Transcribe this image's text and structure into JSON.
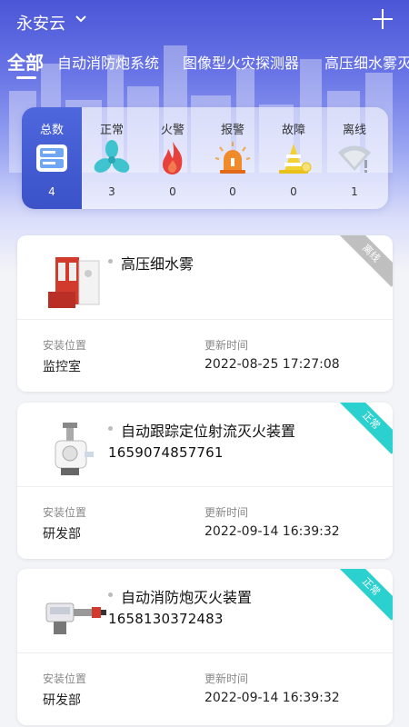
{
  "header": {
    "title": "永安云"
  },
  "tabs": [
    {
      "label": "全部"
    },
    {
      "label": "自动消防炮系统"
    },
    {
      "label": "图像型火灾探测器"
    },
    {
      "label": "高压细水雾灭"
    }
  ],
  "stats": [
    {
      "label": "总数",
      "count": "4",
      "icon": "list-icon"
    },
    {
      "label": "正常",
      "count": "3",
      "icon": "fan-icon"
    },
    {
      "label": "火警",
      "count": "0",
      "icon": "flame-icon"
    },
    {
      "label": "报警",
      "count": "0",
      "icon": "siren-icon"
    },
    {
      "label": "故障",
      "count": "0",
      "icon": "cone-icon"
    },
    {
      "label": "离线",
      "count": "1",
      "icon": "offline-icon"
    }
  ],
  "field_labels": {
    "location": "安装位置",
    "updated": "更新时间"
  },
  "devices": [
    {
      "name": "高压细水雾",
      "code": "",
      "location": "监控室",
      "updated": "2022-08-25 17:27:08",
      "status": "离线"
    },
    {
      "name": "自动跟踪定位射流灭火装置",
      "code": "1659074857761",
      "location": "研发部",
      "updated": "2022-09-14 16:39:32",
      "status": "正常"
    },
    {
      "name": "自动消防炮灭火装置",
      "code": "1658130372483",
      "location": "研发部",
      "updated": "2022-09-14 16:39:32",
      "status": "正常"
    }
  ],
  "colors": {
    "primary": "#4e67dc",
    "normal": "#2bd1cf",
    "offline": "#bfbfbf",
    "fire": "#e8403a",
    "alarm": "#f08a2a",
    "fault": "#f2d233"
  }
}
